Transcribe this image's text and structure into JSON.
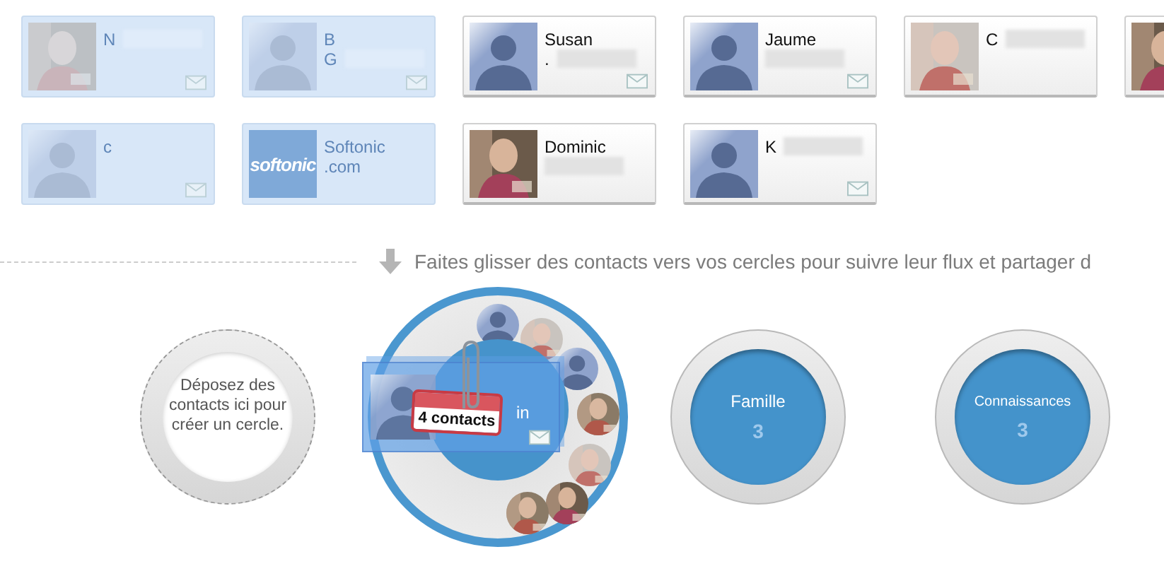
{
  "contacts": [
    {
      "name": "N",
      "selected": true,
      "avatar": {
        "kind": "picture"
      },
      "mail": true,
      "redacted": true
    },
    {
      "name": "B",
      "line2": "G",
      "selected": true,
      "avatar": {
        "kind": "silhouette"
      },
      "mail": true,
      "redacted": true
    },
    {
      "name": "Susan",
      "line2": ".",
      "selected": false,
      "avatar": {
        "kind": "silhouette"
      },
      "mail": true,
      "redacted": true
    },
    {
      "name": "Jaume",
      "selected": false,
      "avatar": {
        "kind": "silhouette"
      },
      "mail": true,
      "redacted": true
    },
    {
      "name": "C",
      "selected": false,
      "avatar": {
        "kind": "picture"
      },
      "mail": false,
      "redacted": true
    },
    {
      "selected": false,
      "avatar": {
        "kind": "picture"
      },
      "mail": false,
      "redacted": false
    },
    {
      "name": "c",
      "selected": true,
      "avatar": {
        "kind": "silhouette"
      },
      "mail": true,
      "redacted": false
    },
    {
      "name": "Softonic",
      "line2": ".com",
      "selected": true,
      "avatar": {
        "kind": "logo",
        "text": "softonic"
      },
      "mail": false,
      "redacted": false
    },
    {
      "name": "Dominic",
      "selected": false,
      "avatar": {
        "kind": "picture"
      },
      "mail": false,
      "redacted": true
    },
    {
      "name": "K",
      "selected": false,
      "avatar": {
        "kind": "silhouette"
      },
      "mail": true,
      "redacted": true
    }
  ],
  "hint": "Faites glisser des contacts vers vos cercles pour suivre leur flux et partager d",
  "circles": [
    {
      "kind": "drop",
      "text": "Déposez des contacts ici pour créer un cercle."
    },
    {
      "kind": "open",
      "card_text": "in",
      "badge": "4 contacts",
      "members": [
        {
          "kind": "silhouette"
        },
        {
          "kind": "picture"
        },
        {
          "kind": "silhouette"
        },
        {
          "kind": "picture"
        },
        {
          "kind": "picture"
        },
        {
          "kind": "picture"
        },
        {
          "kind": "picture"
        }
      ]
    },
    {
      "kind": "closed",
      "name": "Famille",
      "count": "3"
    },
    {
      "kind": "closed",
      "name": "Connaissances",
      "count": "3"
    }
  ]
}
